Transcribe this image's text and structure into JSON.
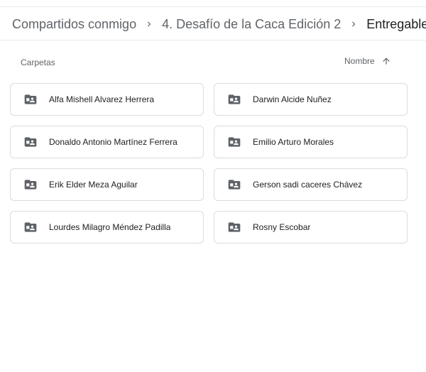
{
  "breadcrumb": {
    "items": [
      "Compartidos conmigo",
      "4. Desafío de la Caca Edición 2"
    ],
    "current": "Entregable",
    "separator_icon": "chevron-right-icon",
    "dropdown_icon": "caret-down-icon"
  },
  "section": {
    "label": "Carpetas"
  },
  "sort": {
    "label": "Nombre",
    "direction": "ascending",
    "icon": "arrow-up-icon"
  },
  "folders": [
    {
      "name": "Alfa Mishell Alvarez Herrera",
      "icon": "shared-folder-icon"
    },
    {
      "name": "Darwin Alcide Nuñez",
      "icon": "shared-folder-icon"
    },
    {
      "name": "Donaldo Antonio Martínez Ferrera",
      "icon": "shared-folder-icon"
    },
    {
      "name": "Emilio Arturo Morales",
      "icon": "shared-folder-icon"
    },
    {
      "name": "Erik Elder Meza Aguilar",
      "icon": "shared-folder-icon"
    },
    {
      "name": "Gerson sadi caceres Chávez",
      "icon": "shared-folder-icon"
    },
    {
      "name": "Lourdes Milagro Méndez Padilla",
      "icon": "shared-folder-icon"
    },
    {
      "name": "Rosny Escobar",
      "icon": "shared-folder-icon"
    }
  ],
  "colors": {
    "text_primary": "#202124",
    "text_secondary": "#5f6368",
    "border": "#dadce0",
    "icon": "#5f6368"
  }
}
